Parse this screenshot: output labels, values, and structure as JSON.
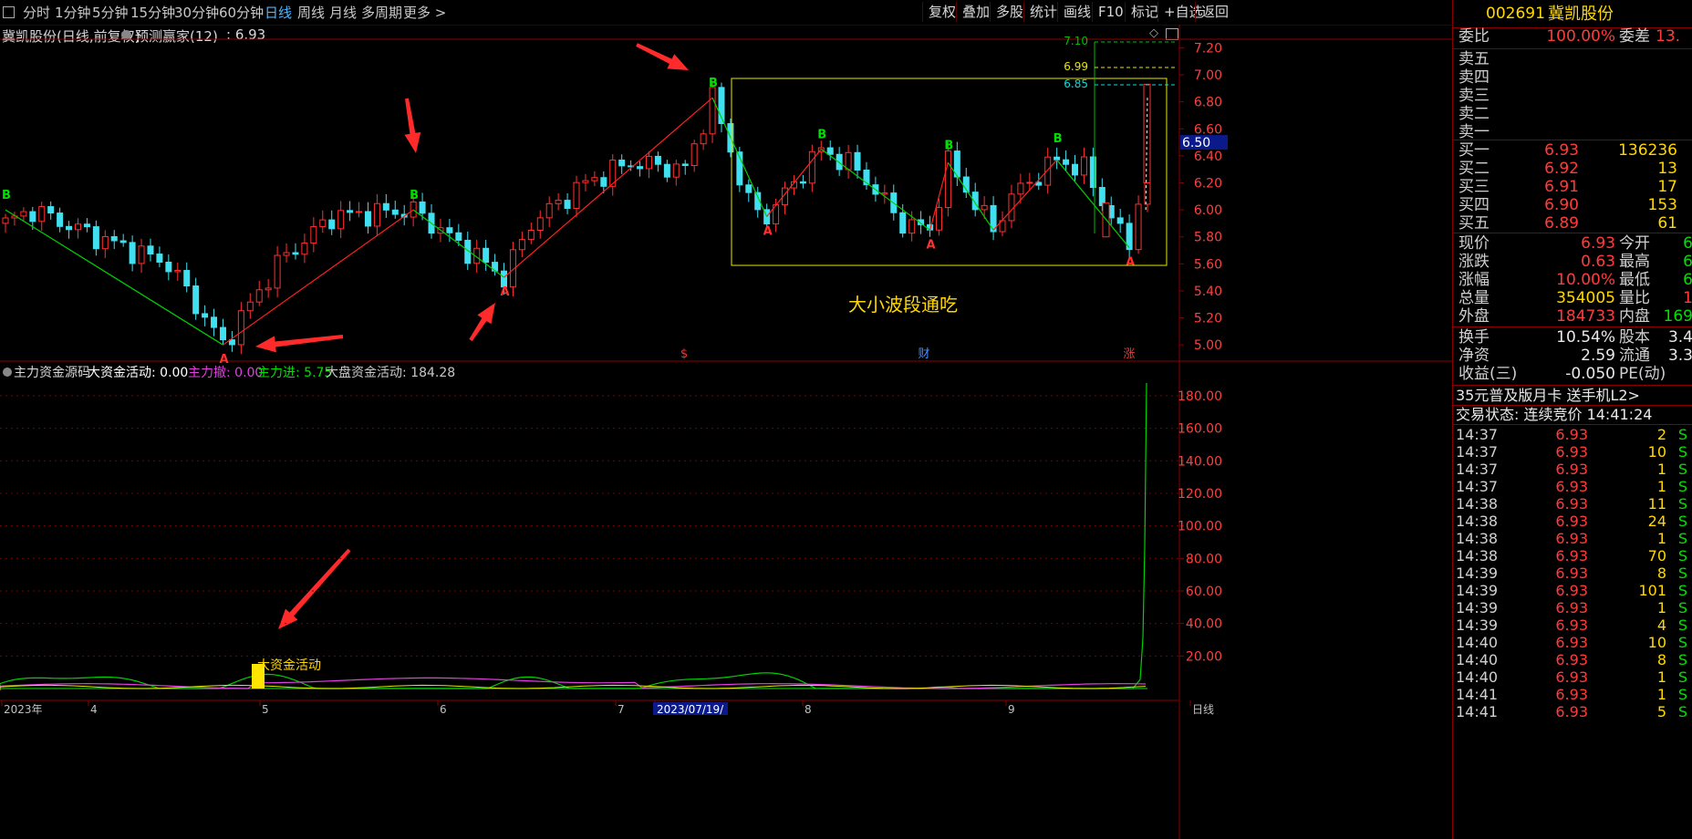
{
  "toolbar": {
    "left_items": [
      "分时",
      "1分钟",
      "5分钟",
      "15分钟",
      "30分钟",
      "60分钟",
      "日线",
      "周线",
      "月线",
      "多周期",
      "更多 >"
    ],
    "active_item": "日线",
    "right_items": [
      "复权",
      "叠加",
      "多股",
      "统计",
      "画线",
      "F10",
      "标记",
      "+自选",
      "返回"
    ]
  },
  "main_chart": {
    "title": "冀凯股份(日线,前复权)",
    "indicator": "预测赢家(12)",
    "indicator_value": ": 6.93",
    "annotation": "大小波段通吃",
    "current_price_tag": "6.50",
    "levels": [
      "7.10",
      "6.99",
      "6.85"
    ],
    "y_ticks": [
      "7.20",
      "7.00",
      "6.80",
      "6.60",
      "6.40",
      "6.20",
      "6.00",
      "5.80",
      "5.60",
      "5.40",
      "5.20",
      "5.00"
    ],
    "markers": [
      "$",
      "财",
      "涨"
    ],
    "buy_label": "B",
    "sell_label": "A"
  },
  "sub_chart": {
    "title": "主力资金源码",
    "big_money_label": "大资金活动: 0.00",
    "main_out_label": "主力撤: 0.00",
    "main_in_label": "主力进: 5.75",
    "market_label": "大盘资金活动: 184.28",
    "annotation": "大资金活动",
    "y_ticks": [
      "180.00",
      "160.00",
      "140.00",
      "120.00",
      "100.00",
      "80.00",
      "60.00",
      "40.00",
      "20.00"
    ],
    "x_labels": [
      "2023年",
      "4",
      "5",
      "6",
      "7",
      "2023/07/19/",
      "8",
      "9",
      "日线"
    ]
  },
  "chart_data": {
    "type": "candlestick",
    "title": "冀凯股份(日线,前复权)",
    "ylim": [
      4.9,
      7.25
    ],
    "last_close": 6.93,
    "signal_points": [
      {
        "label": "B",
        "price": 6.0
      },
      {
        "label": "A",
        "price": 5.0
      },
      {
        "label": "B",
        "price": 6.0
      },
      {
        "label": "A",
        "price": 5.5
      },
      {
        "label": "B",
        "price": 6.83
      },
      {
        "label": "A",
        "price": 5.95
      },
      {
        "label": "B",
        "price": 6.45
      },
      {
        "label": "A",
        "price": 5.85
      },
      {
        "label": "B",
        "price": 6.37
      },
      {
        "label": "B",
        "price": 6.42
      },
      {
        "label": "A",
        "price": 5.72
      }
    ],
    "sub_series": [
      {
        "name": "大盘资金活动",
        "last": 184.28
      },
      {
        "name": "主力进",
        "last": 5.75
      },
      {
        "name": "主力撤",
        "last": 0.0
      },
      {
        "name": "大资金活动",
        "last": 0.0
      }
    ],
    "sub_ylim": [
      0,
      185
    ]
  },
  "quote": {
    "code": "002691",
    "name": "冀凯股份",
    "wb_label": "委比",
    "wb_value": "100.00%",
    "wc_label": "委差",
    "wc_value": "13.",
    "sell_labels": [
      "卖五",
      "卖四",
      "卖三",
      "卖二",
      "卖一"
    ],
    "buys": [
      {
        "label": "买一",
        "price": "6.93",
        "vol": "136236"
      },
      {
        "label": "买二",
        "price": "6.92",
        "vol": "13"
      },
      {
        "label": "买三",
        "price": "6.91",
        "vol": "17"
      },
      {
        "label": "买四",
        "price": "6.90",
        "vol": "153"
      },
      {
        "label": "买五",
        "price": "6.89",
        "vol": "61"
      }
    ],
    "stats_left": [
      {
        "label": "现价",
        "value": "6.93"
      },
      {
        "label": "涨跌",
        "value": "0.63"
      },
      {
        "label": "涨幅",
        "value": "10.00%"
      },
      {
        "label": "总量",
        "value": "354005"
      },
      {
        "label": "外盘",
        "value": "184733"
      }
    ],
    "stats_right": [
      {
        "label": "今开",
        "value": "6"
      },
      {
        "label": "最高",
        "value": "6"
      },
      {
        "label": "最低",
        "value": "6"
      },
      {
        "label": "量比",
        "value": "1"
      },
      {
        "label": "内盘",
        "value": "169"
      }
    ],
    "stats2_left": [
      {
        "label": "换手",
        "value": "10.54%"
      },
      {
        "label": "净资",
        "value": "2.59"
      },
      {
        "label": "收益(三)",
        "value": "-0.050"
      }
    ],
    "stats2_right": [
      {
        "label": "股本",
        "value": "3.4"
      },
      {
        "label": "流通",
        "value": "3.3"
      },
      {
        "label": "PE(动)",
        "value": ""
      }
    ],
    "promo": "35元普及版月卡 送手机L2>",
    "status": "交易状态: 连续竞价 14:41:24",
    "ticks": [
      {
        "time": "14:37",
        "price": "6.93",
        "vol": "2",
        "side": "S"
      },
      {
        "time": "14:37",
        "price": "6.93",
        "vol": "10",
        "side": "S"
      },
      {
        "time": "14:37",
        "price": "6.93",
        "vol": "1",
        "side": "S"
      },
      {
        "time": "14:37",
        "price": "6.93",
        "vol": "1",
        "side": "S"
      },
      {
        "time": "14:38",
        "price": "6.93",
        "vol": "11",
        "side": "S"
      },
      {
        "time": "14:38",
        "price": "6.93",
        "vol": "24",
        "side": "S"
      },
      {
        "time": "14:38",
        "price": "6.93",
        "vol": "1",
        "side": "S"
      },
      {
        "time": "14:38",
        "price": "6.93",
        "vol": "70",
        "side": "S"
      },
      {
        "time": "14:39",
        "price": "6.93",
        "vol": "8",
        "side": "S"
      },
      {
        "time": "14:39",
        "price": "6.93",
        "vol": "101",
        "side": "S"
      },
      {
        "time": "14:39",
        "price": "6.93",
        "vol": "1",
        "side": "S"
      },
      {
        "time": "14:39",
        "price": "6.93",
        "vol": "4",
        "side": "S"
      },
      {
        "time": "14:40",
        "price": "6.93",
        "vol": "10",
        "side": "S"
      },
      {
        "time": "14:40",
        "price": "6.93",
        "vol": "8",
        "side": "S"
      },
      {
        "time": "14:40",
        "price": "6.93",
        "vol": "1",
        "side": "S"
      },
      {
        "time": "14:41",
        "price": "6.93",
        "vol": "1",
        "side": "S"
      },
      {
        "time": "14:41",
        "price": "6.93",
        "vol": "5",
        "side": "S"
      }
    ]
  }
}
